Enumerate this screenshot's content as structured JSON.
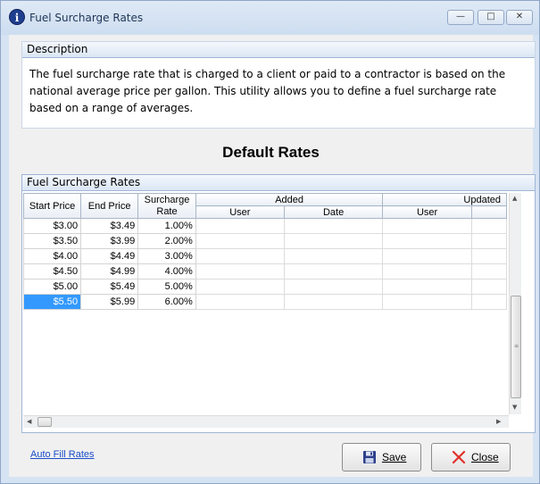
{
  "window": {
    "title": "Fuel Surcharge Rates",
    "info_icon": "i",
    "minimize_glyph": "—",
    "maximize_glyph": "□",
    "close_glyph": "✕"
  },
  "description": {
    "header": "Description",
    "text": "The fuel surcharge rate that is charged to a client or paid to a contractor is based on the national average price per gallon.  This utility allows you to define a fuel surcharge rate based on a range of averages."
  },
  "section_title": "Default Rates",
  "grid": {
    "header": "Fuel Surcharge Rates",
    "columns": {
      "start_price": "Start Price",
      "end_price": "End Price",
      "surcharge_rate": "Surcharge Rate",
      "added": "Added",
      "updated": "Updated",
      "user": "User",
      "date": "Date"
    },
    "rows": [
      {
        "start": "$3.00",
        "end": "$3.49",
        "rate": "1.00%"
      },
      {
        "start": "$3.50",
        "end": "$3.99",
        "rate": "2.00%"
      },
      {
        "start": "$4.00",
        "end": "$4.49",
        "rate": "3.00%"
      },
      {
        "start": "$4.50",
        "end": "$4.99",
        "rate": "4.00%"
      },
      {
        "start": "$5.00",
        "end": "$5.49",
        "rate": "5.00%"
      },
      {
        "start": "$5.50",
        "end": "$5.99",
        "rate": "6.00%"
      }
    ],
    "selected_row": 5
  },
  "footer": {
    "auto_fill_link": "Auto Fill Rates",
    "save_label": "Save",
    "close_label": "Close"
  },
  "colors": {
    "selection": "#3399ff",
    "link": "#1a4ec9",
    "window_frame": "#d6e3f3"
  }
}
